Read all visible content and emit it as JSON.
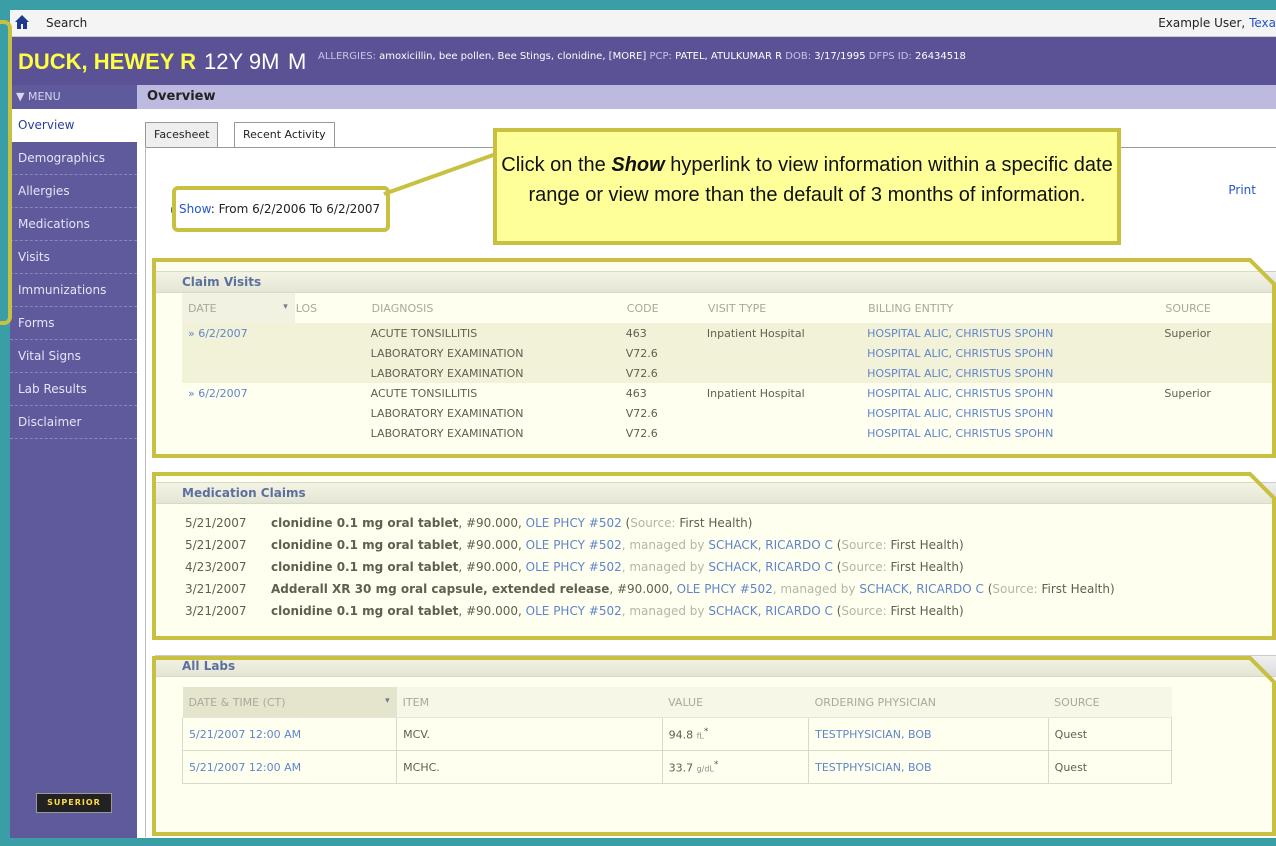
{
  "topbar": {
    "search_label": "Search",
    "user_label": "Example User,",
    "user_link": "Texa"
  },
  "patient": {
    "name": "DUCK, HEWEY R",
    "age": "12Y 9M",
    "sex": "M",
    "allergies_label": "ALLERGIES:",
    "allergies": "amoxicillin, bee pollen, Bee Stings, clonidine, [MORE]",
    "pcp_label": "PCP:",
    "pcp": "PATEL, ATULKUMAR R",
    "dob_label": "DOB:",
    "dob": "3/17/1995",
    "dfps_label": "DFPS ID:",
    "dfps": "26434518"
  },
  "menu": {
    "header": "▼ MENU",
    "items": [
      "Overview",
      "Demographics",
      "Allergies",
      "Medications",
      "Visits",
      "Immunizations",
      "Forms",
      "Vital Signs",
      "Lab Results",
      "Disclaimer"
    ],
    "active": "Overview"
  },
  "logo_text": "SUPERIOR",
  "page": {
    "title": "Overview",
    "tabs": [
      "Facesheet",
      "Recent Activity"
    ],
    "print": "Print"
  },
  "show": {
    "link": "Show",
    "range": ": From 6/2/2006 To 6/2/2007"
  },
  "callout": {
    "pre": "Click on the ",
    "emph": "Show",
    "post": " hyperlink to view information within a specific date range or view more than the default of 3 months of information."
  },
  "claims": {
    "title": "Claim Visits",
    "headers": [
      "DATE",
      "LOS",
      "DIAGNOSIS",
      "CODE",
      "VISIT TYPE",
      "BILLING ENTITY",
      "SOURCE"
    ],
    "rows": [
      {
        "date": "» 6/2/2007",
        "diagnosis": "ACUTE TONSILLITIS",
        "code": "463",
        "visit_type": "Inpatient Hospital",
        "billing": "HOSPITAL ALIC, CHRISTUS SPOHN",
        "source": "Superior",
        "shade": true
      },
      {
        "date": "",
        "diagnosis": "LABORATORY EXAMINATION",
        "code": "V72.6",
        "visit_type": "",
        "billing": "HOSPITAL ALIC, CHRISTUS SPOHN",
        "source": "",
        "shade": true
      },
      {
        "date": "",
        "diagnosis": "LABORATORY EXAMINATION",
        "code": "V72.6",
        "visit_type": "",
        "billing": "HOSPITAL ALIC, CHRISTUS SPOHN",
        "source": "",
        "shade": true
      },
      {
        "date": "» 6/2/2007",
        "diagnosis": "ACUTE TONSILLITIS",
        "code": "463",
        "visit_type": "Inpatient Hospital",
        "billing": "HOSPITAL ALIC, CHRISTUS SPOHN",
        "source": "Superior",
        "shade": false
      },
      {
        "date": "",
        "diagnosis": "LABORATORY EXAMINATION",
        "code": "V72.6",
        "visit_type": "",
        "billing": "HOSPITAL ALIC, CHRISTUS SPOHN",
        "source": "",
        "shade": false
      },
      {
        "date": "",
        "diagnosis": "LABORATORY EXAMINATION",
        "code": "V72.6",
        "visit_type": "",
        "billing": "HOSPITAL ALIC, CHRISTUS SPOHN",
        "source": "",
        "shade": false
      }
    ]
  },
  "meds": {
    "title": "Medication Claims",
    "rows": [
      {
        "date": "5/21/2007",
        "drug": "clonidine 0.1 mg oral tablet",
        "qty": ", #90.000, ",
        "pharmacy": "OLE PHCY #502",
        "managed": "",
        "source": "First Health"
      },
      {
        "date": "5/21/2007",
        "drug": "clonidine 0.1 mg oral tablet",
        "qty": ", #90.000, ",
        "pharmacy": "OLE PHCY #502",
        "managed": "SCHACK, RICARDO C",
        "source": "First Health"
      },
      {
        "date": "4/23/2007",
        "drug": "clonidine 0.1 mg oral tablet",
        "qty": ", #90.000, ",
        "pharmacy": "OLE PHCY #502",
        "managed": "SCHACK, RICARDO C",
        "source": "First Health"
      },
      {
        "date": "3/21/2007",
        "drug": "Adderall XR 30 mg oral capsule, extended release",
        "qty": ", #90.000, ",
        "pharmacy": "OLE PHCY #502",
        "managed": "SCHACK, RICARDO C",
        "source": "First Health"
      },
      {
        "date": "3/21/2007",
        "drug": "clonidine 0.1 mg oral tablet",
        "qty": ", #90.000, ",
        "pharmacy": "OLE PHCY #502",
        "managed": "SCHACK, RICARDO C",
        "source": "First Health"
      }
    ],
    "managed_label": ", managed by ",
    "source_label": "Source: "
  },
  "labs": {
    "title": "All Labs",
    "headers": [
      "DATE & TIME (CT)",
      "ITEM",
      "VALUE",
      "ORDERING PHYSICIAN",
      "SOURCE"
    ],
    "rows": [
      {
        "datetime": "5/21/2007 12:00 AM",
        "item": "MCV.",
        "value": "94.8",
        "unit": "fL",
        "flag": "*",
        "physician": "TESTPHYSICIAN, BOB",
        "source": "Quest"
      },
      {
        "datetime": "5/21/2007 12:00 AM",
        "item": "MCHC.",
        "value": "33.7",
        "unit": "g/dL",
        "flag": "*",
        "physician": "TESTPHYSICIAN, BOB",
        "source": "Quest"
      }
    ]
  },
  "colors": {
    "accent_yellow": "#c8c040",
    "purple": "#5a5294",
    "link": "#2255cc"
  },
  "icons": {
    "home": "home-icon",
    "sort": "sort-arrow-icon"
  }
}
